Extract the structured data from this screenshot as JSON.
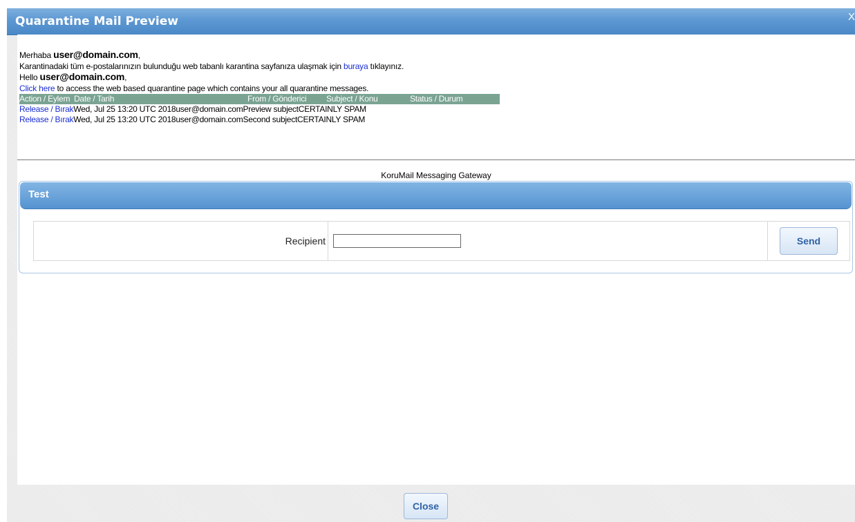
{
  "window": {
    "title": "Quarantine Mail Preview",
    "close_glyph": "X"
  },
  "mail": {
    "greeting_tr_prefix": "Merhaba ",
    "greeting_tr_user": "user@domain.com",
    "greeting_tr_suffix": ",",
    "body_tr_before": "Karantinadaki tüm e-postalarınızın bulunduğu web tabanlı karantina sayfanıza ulaşmak için ",
    "body_tr_link": "buraya",
    "body_tr_after": " tıklayınız.",
    "greeting_en_prefix": "Hello ",
    "greeting_en_user": "user@domain.com",
    "greeting_en_suffix": ",",
    "body_en_link": "Click here",
    "body_en_after": " to access the web based quarantine page which contains your all quarantine messages.",
    "table_headers": [
      "Action / Eylem",
      "Date / Tarih",
      "From / Gönderici",
      "Subject / Konu",
      "Status / Durum"
    ],
    "rows": [
      {
        "action": "Release / Bırak",
        "date": "Wed, Jul 25 13:20 UTC 2018",
        "from": "user@domain.com",
        "subject": "Preview subject",
        "status": "CERTAINLY SPAM"
      },
      {
        "action": "Release / Bırak",
        "date": "Wed, Jul 25 13:20 UTC 2018",
        "from": "user@domain.com",
        "subject": "Second subject",
        "status": "CERTAINLY SPAM"
      }
    ]
  },
  "footer_text": "KoruMail Messaging Gateway",
  "test_panel": {
    "title": "Test",
    "recipient_label": "Recipient",
    "recipient_value": "",
    "send_label": "Send"
  },
  "close_label": "Close"
}
